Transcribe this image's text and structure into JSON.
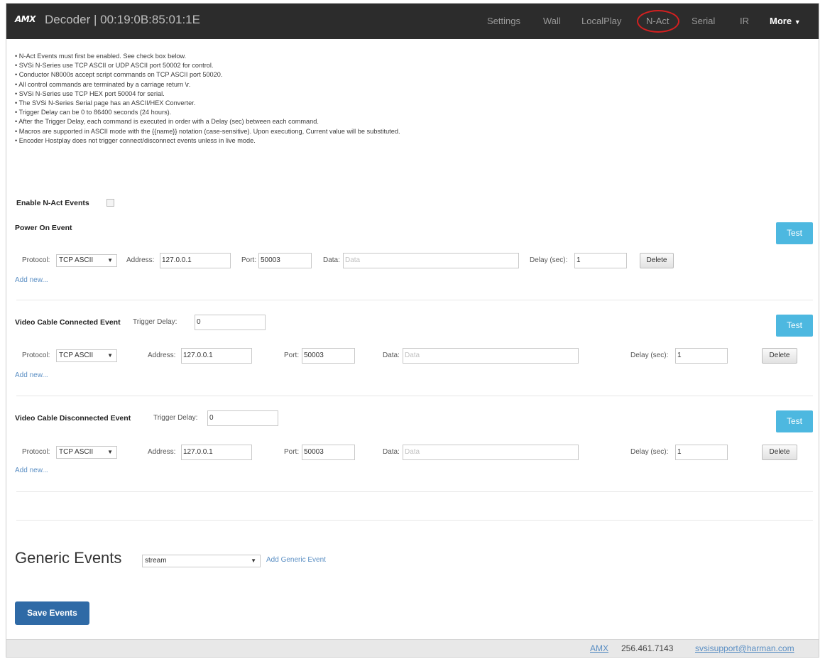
{
  "navbar": {
    "logo": "AMX",
    "title": "Decoder | 00:19:0B:85:01:1E",
    "items": [
      "Settings",
      "Wall",
      "LocalPlay",
      "N-Act",
      "Serial",
      "IR"
    ],
    "more": "More",
    "active_item": "N-Act"
  },
  "notes": [
    "• N-Act Events must first be enabled. See check box below.",
    "• SVSi N-Series use TCP ASCII or UDP ASCII port 50002 for control.",
    "• Conductor N8000s accept script commands on TCP ASCII port 50020.",
    "• All control commands are terminated by a carriage return \\r.",
    "• SVSi N-Series use TCP HEX port 50004 for serial.",
    "• The SVSi N-Series Serial page has an ASCII/HEX Converter.",
    "• Trigger Delay can be 0 to 86400 seconds (24 hours).",
    "• After the Trigger Delay, each command is executed in order with a Delay (sec) between each command.",
    "• Macros are supported in ASCII mode with the {{name}} notation (case-sensitive). Upon executiong, Current value will be substituted.",
    "• Encoder Hostplay does not trigger connect/disconnect events unless in live mode."
  ],
  "enable_label": "Enable N-Act Events",
  "labels": {
    "protocol": "Protocol:",
    "address": "Address:",
    "port": "Port:",
    "data": "Data:",
    "delay": "Delay (sec):",
    "trigger_delay": "Trigger Delay:",
    "delete": "Delete",
    "test": "Test",
    "add_new": "Add new...",
    "caret": "▼"
  },
  "events": [
    {
      "title": "Power On Event",
      "protocol": "TCP ASCII",
      "address": "127.0.0.1",
      "port": "50003",
      "data_placeholder": "Data",
      "delay": "1"
    },
    {
      "title": "Video Cable Connected Event",
      "trigger_delay": "0",
      "protocol": "TCP ASCII",
      "address": "127.0.0.1",
      "port": "50003",
      "data_placeholder": "Data",
      "delay": "1"
    },
    {
      "title": "Video Cable Disconnected Event",
      "trigger_delay": "0",
      "protocol": "TCP ASCII",
      "address": "127.0.0.1",
      "port": "50003",
      "data_placeholder": "Data",
      "delay": "1"
    }
  ],
  "generic": {
    "title": "Generic Events",
    "selected": "stream",
    "add_label": "Add Generic Event"
  },
  "save_label": "Save Events",
  "footer": {
    "brand": "AMX",
    "phone": "256.461.7143",
    "email": "svsisupport@harman.com"
  }
}
